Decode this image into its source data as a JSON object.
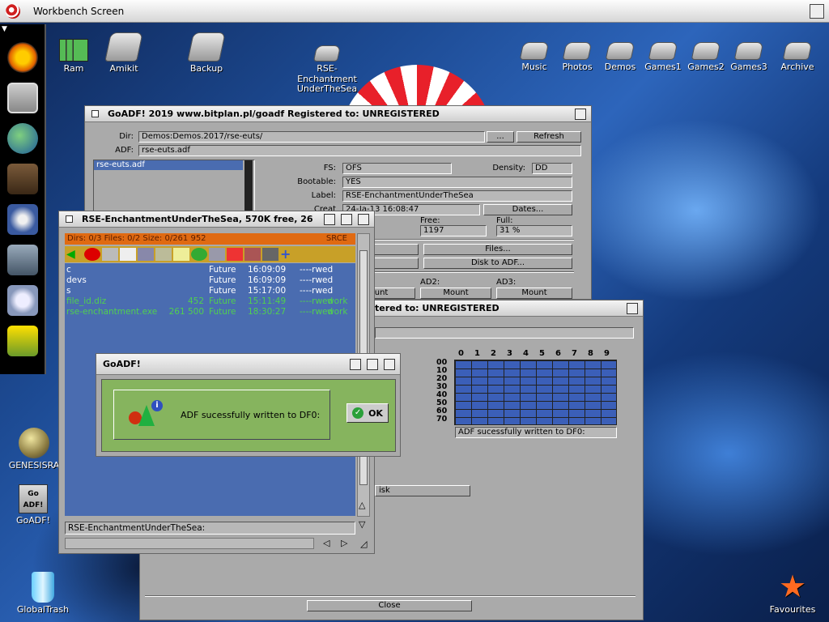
{
  "screen": {
    "title": "Workbench Screen"
  },
  "desktop_icons": {
    "ram": "Ram",
    "amikit": "Amikit",
    "backup": "Backup",
    "rse": "RSE-\nEnchantment\nUnderTheSea",
    "music": "Music",
    "photos": "Photos",
    "demos": "Demos",
    "games1": "Games1",
    "games2": "Games2",
    "games3": "Games3",
    "archive": "Archive",
    "genesis": "GENESISRA",
    "goadf": "GoADF!",
    "goadf_icon_text": "Go ADF!",
    "trash": "GlobalTrash",
    "favourites": "Favourites"
  },
  "goadf_main": {
    "title": "GoADF! 2019 www.bitplan.pl/goadf  Registered to: UNREGISTERED",
    "dir_label": "Dir:",
    "dir_value": "Demos:Demos.2017/rse-euts/",
    "browse_btn": "...",
    "refresh_btn": "Refresh",
    "adf_label": "ADF:",
    "adf_value": "rse-euts.adf",
    "list_item": "rse-euts.adf",
    "fs_label": "FS:",
    "fs_value": "OFS",
    "density_label": "Density:",
    "density_value": "DD",
    "bootable_label": "Bootable:",
    "bootable_value": "YES",
    "label_label": "Label:",
    "label_value": "RSE-EnchantmentUnderTheSea",
    "created_partial": "Creat",
    "created_value": "24-Ja-13 16:08:47",
    "dates_btn": "Dates...",
    "free_label": "Free:",
    "free_value": "1197",
    "full_label": "Full:",
    "full_value": "31 %",
    "files_btn": "Files...",
    "disk_to_adf_btn": "Disk to ADF...",
    "ad2_label": "AD2:",
    "ad3_label": "AD3:",
    "mount_btn": "Mount",
    "mount_partial": "ount"
  },
  "goadf_second": {
    "title_partial": "tered to: UNREGISTERED",
    "grid_cols": [
      "0",
      "1",
      "2",
      "3",
      "4",
      "5",
      "6",
      "7",
      "8",
      "9"
    ],
    "grid_rows": [
      "00",
      "10",
      "20",
      "30",
      "40",
      "50",
      "60",
      "70"
    ],
    "status": "ADF sucessfully written to DF0:",
    "disk_btn_partial": "isk",
    "close_btn": "Close"
  },
  "drawer": {
    "title": "RSE-EnchantmentUnderTheSea,  570K free, 26",
    "info_bar": "Dirs: 0/3   Files: 0/2   Size: 0/261 952",
    "srce": "SRCE",
    "files": [
      {
        "name": "c",
        "size": "",
        "date": "Future",
        "time": "16:09:09",
        "prot": "----rwed",
        "comment": "",
        "isfile": false
      },
      {
        "name": "devs",
        "size": "",
        "date": "Future",
        "time": "16:09:09",
        "prot": "----rwed",
        "comment": "",
        "isfile": false
      },
      {
        "name": "s",
        "size": "",
        "date": "Future",
        "time": "15:17:00",
        "prot": "----rwed",
        "comment": "",
        "isfile": false
      },
      {
        "name": "file_id.diz",
        "size": "452",
        "date": "Future",
        "time": "15:11:49",
        "prot": "----rwed",
        "comment": "work",
        "isfile": true
      },
      {
        "name": "rse-enchantment.exe",
        "size": "261 500",
        "date": "Future",
        "time": "18:30:27",
        "prot": "----rwed",
        "comment": "work",
        "isfile": true
      }
    ],
    "path": "RSE-EnchantmentUnderTheSea:"
  },
  "dialog": {
    "title": "GoADF!",
    "message": "ADF sucessfully written to DF0:",
    "ok_label": "OK"
  },
  "colors": {
    "drawer_bg": "#4a6cb0",
    "info_bar": "#e06a12",
    "dialog_bg": "#86b45e"
  }
}
